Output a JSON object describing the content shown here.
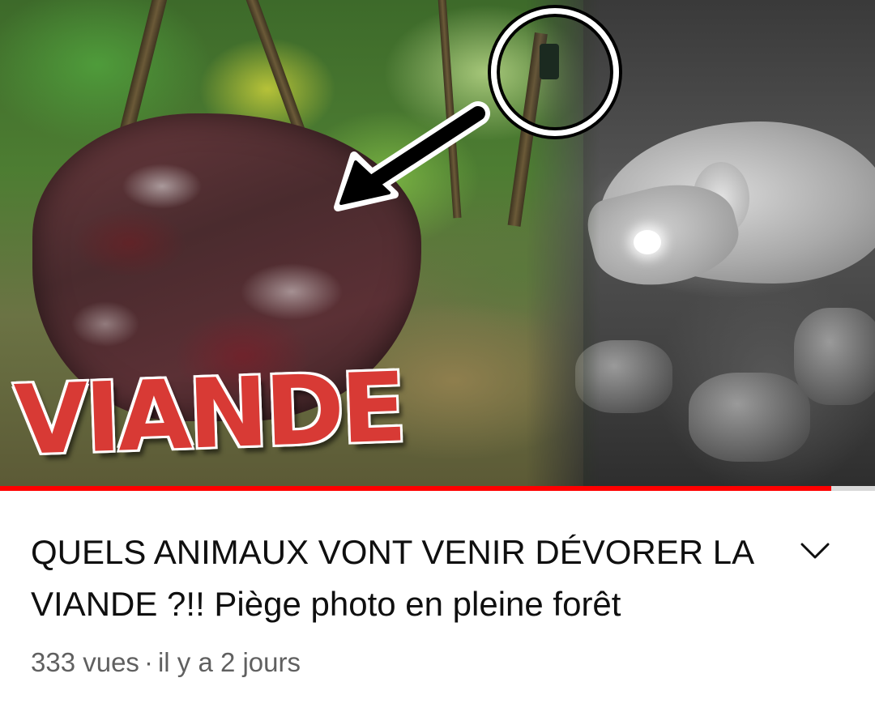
{
  "thumbnail": {
    "overlay_text": "VIANDE",
    "progress_watched_fraction": 0.95
  },
  "video": {
    "title": "QUELS ANIMAUX VONT VENIR DÉVORER LA VIANDE ?!! Piège photo en pleine forêt",
    "views": "333 vues",
    "separator": "·",
    "published": "il y a 2 jours"
  },
  "icons": {
    "expand": "chevron-down-icon"
  },
  "colors": {
    "progress": "#ff0000",
    "title": "#0f0f0f",
    "meta": "#606060",
    "overlay_text": "#d83a35"
  }
}
